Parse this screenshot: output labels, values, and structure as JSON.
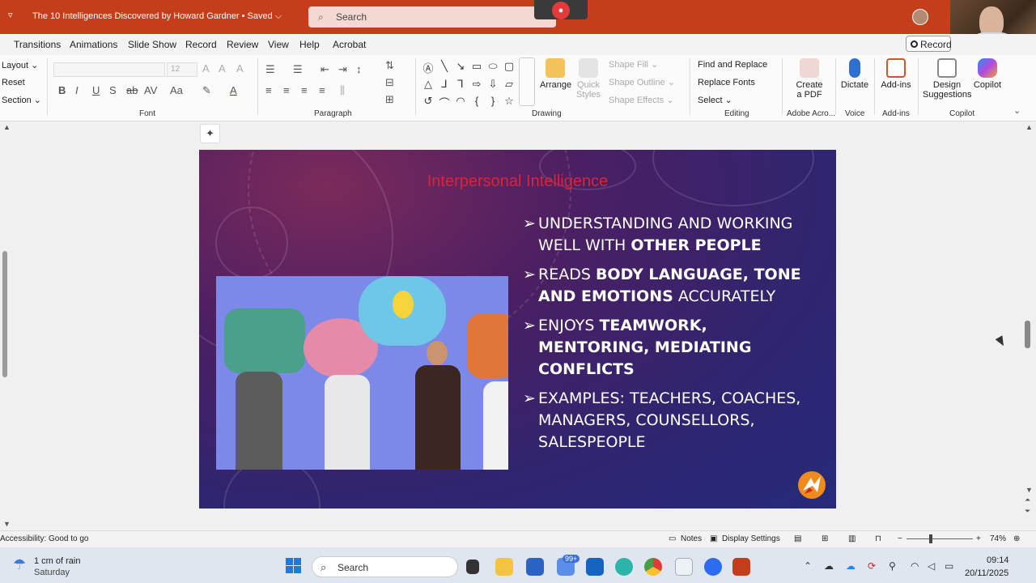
{
  "window": {
    "doc_title": "The 10 Intelligences Discovered by Howard Gardner • Saved ⌵",
    "search_placeholder": "Search",
    "record_label": "Record"
  },
  "menu": [
    "Transitions",
    "Animations",
    "Slide Show",
    "Record",
    "Review",
    "View",
    "Help",
    "Acrobat"
  ],
  "ribbon": {
    "slides": {
      "layout": "Layout ⌄",
      "reset": "Reset",
      "section": "Section ⌄"
    },
    "font": {
      "label": "Font",
      "size": "12"
    },
    "paragraph": {
      "label": "Paragraph"
    },
    "drawing": {
      "label": "Drawing",
      "arrange": "Arrange",
      "quick_styles": "Quick Styles",
      "shape_fill": "Shape Fill ⌄",
      "shape_outline": "Shape Outline ⌄",
      "shape_effects": "Shape Effects ⌄"
    },
    "editing": {
      "label": "Editing",
      "find_replace": "Find and Replace",
      "replace_fonts": "Replace Fonts",
      "select": "Select ⌄"
    },
    "adobe": {
      "label": "Adobe Acro...",
      "create_pdf_1": "Create",
      "create_pdf_2": "a PDF"
    },
    "voice": {
      "label": "Voice",
      "dictate": "Dictate"
    },
    "addins": {
      "label": "Add-ins",
      "btn": "Add-ins"
    },
    "copilot": {
      "label": "Copilot",
      "design_1": "Design",
      "design_2": "Suggestions",
      "copilot": "Copilot"
    }
  },
  "slide": {
    "title": "Interpersonal Intelligence",
    "bullets": [
      {
        "pre": "UNDERSTANDING AND WORKING WELL WITH ",
        "bold": "OTHER PEOPLE",
        "post": ""
      },
      {
        "pre": "READS ",
        "bold": "BODY LANGUAGE, TONE AND EMOTIONS",
        "post": " ACCURATELY"
      },
      {
        "pre": "ENJOYS ",
        "bold": "TEAMWORK, MENTORING, MEDIATING CONFLICTS",
        "post": ""
      },
      {
        "pre": "EXAMPLES: TEACHERS, COACHES, MANAGERS, COUNSELLORS, SALESPEOPLE",
        "bold": "",
        "post": ""
      }
    ],
    "bullet_marker": "➢"
  },
  "status": {
    "accessibility": "Accessibility: Good to go",
    "notes": "Notes",
    "display_settings": "Display Settings",
    "zoom": "74%"
  },
  "taskbar": {
    "weather_line1": "1 cm of rain",
    "weather_line2": "Saturday",
    "search": "Search",
    "mail_badge": "99+",
    "time": "09:14",
    "date": "20/11/2025"
  },
  "colors": {
    "titlebar": "#c43e1c",
    "slide_title": "#d8243a",
    "accent_blue": "#1f7ae0"
  }
}
